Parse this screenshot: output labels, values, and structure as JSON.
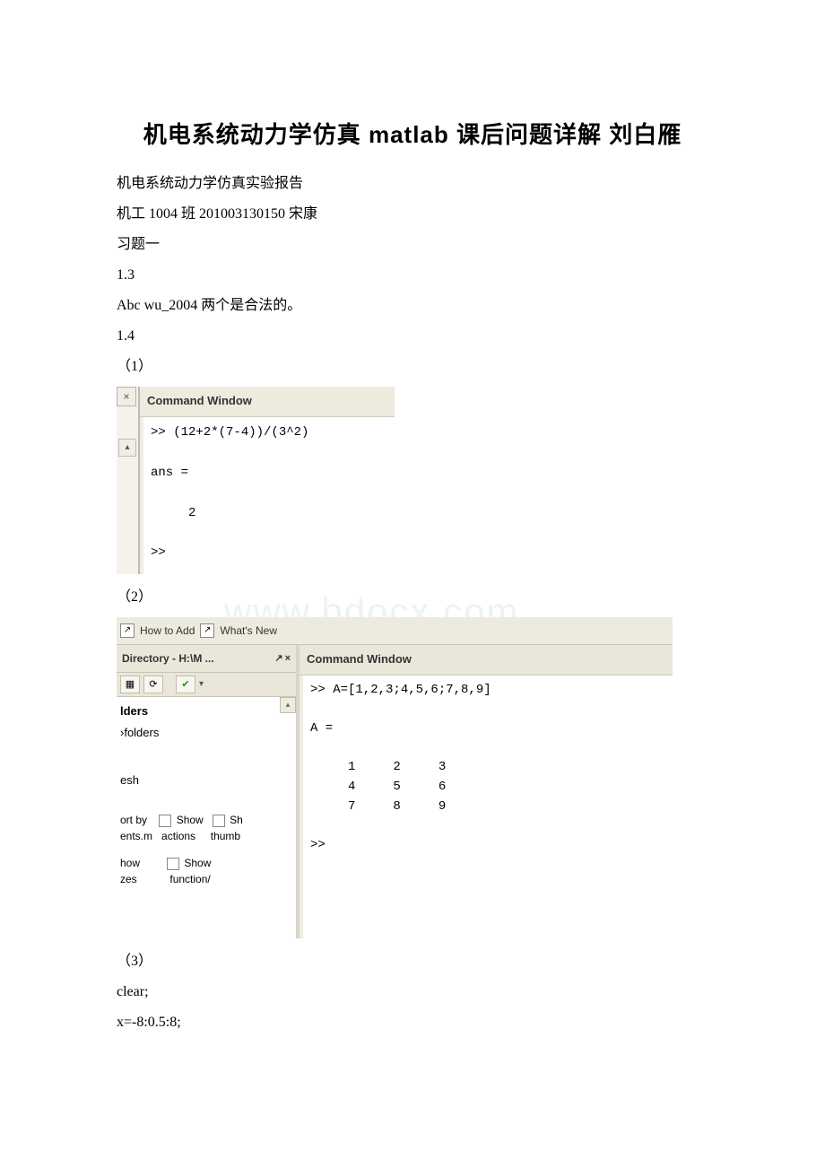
{
  "title": "机电系统动力学仿真 matlab 课后问题详解 刘白雁",
  "lines": {
    "l1": "机电系统动力学仿真实验报告",
    "l2": "机工 1004 班 201003130150 宋康",
    "l3": "习题一",
    "l4": "1.3",
    "l5": "Abc wu_2004 两个是合法的。",
    "l6": "1.4",
    "l7": "（1）",
    "l8": "（2）",
    "l9": "（3）",
    "l10": "clear;",
    "l11": "x=-8:0.5:8;"
  },
  "watermark": "www.bdocx.com",
  "shot1": {
    "close": "×",
    "scroll_up": "▴",
    "cw_title": "Command Window",
    "cw_body": ">> (12+2*(7-4))/(3^2)\n\nans =\n\n     2\n\n>> "
  },
  "shot2": {
    "toolbar": {
      "icon1": "↗",
      "label1": "How to Add",
      "icon2": "↗",
      "label2": "What's New"
    },
    "dir": {
      "title": "Directory - H:\\M ...",
      "pin": "↗",
      "close": "×",
      "tb_icon1": "▦",
      "tb_icon2": "⟳",
      "tb_icon3": "✔",
      "tb_arrow": "▾",
      "scroll_up": "▴",
      "rows": {
        "r1": "lders",
        "r2": "›folders",
        "r3": "esh",
        "r4a": "ort by",
        "r4b": "Show",
        "r4c": "Sh",
        "r5a": "ents.m",
        "r5b": "actions",
        "r5c": "thumb",
        "r6a": "how",
        "r6b": "Show",
        "r7a": "zes",
        "r7b": "function/"
      }
    },
    "cw_title": "Command Window",
    "cw_body": ">> A=[1,2,3;4,5,6;7,8,9]\n\nA =\n\n     1     2     3\n     4     5     6\n     7     8     9\n\n>> "
  }
}
